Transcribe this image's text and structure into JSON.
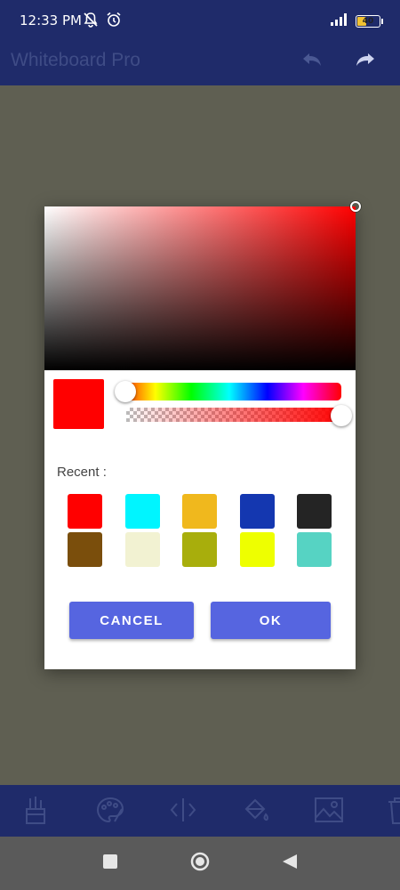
{
  "status_bar": {
    "time": "12:33 PM",
    "battery_level": "40",
    "battery_fraction": 0.4
  },
  "app_bar": {
    "title": "Whiteboard Pro",
    "icons": [
      "undo-icon",
      "redo-icon"
    ]
  },
  "color_dialog": {
    "selected_color": "#ff0000",
    "hue_position": 0.0,
    "alpha_position": 1.0,
    "recent_label": "Recent :",
    "recent_colors": [
      "#ff0000",
      "#00f5ff",
      "#f0b81d",
      "#1437b0",
      "#242424",
      "#7a4e0c",
      "#f2f2d2",
      "#a8ae0c",
      "#eeff00",
      "#56d3c3"
    ],
    "cancel_label": "CANCEL",
    "ok_label": "OK"
  },
  "toolbar": {
    "icons": [
      "pencils-icon",
      "palette-icon",
      "split-icon",
      "paint-bucket-icon",
      "image-icon",
      "trash-icon"
    ]
  },
  "nav_bar": {
    "icons": [
      "recents-square-icon",
      "home-circle-icon",
      "back-triangle-icon"
    ]
  },
  "colors": {
    "bar_background": "#1f2b6a",
    "button_accent": "#5665e0",
    "canvas": "#5f5f52"
  }
}
